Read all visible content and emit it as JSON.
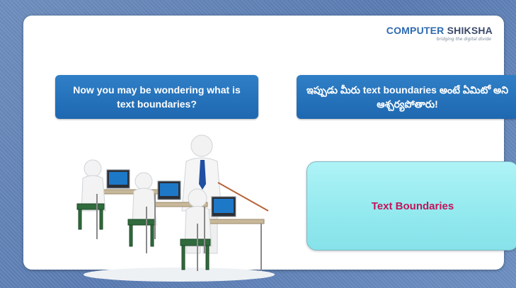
{
  "logo": {
    "brand_part1": "COMPUTER",
    "brand_part2": " SHIKSHA",
    "tagline": "bridging the digital divide"
  },
  "callouts": {
    "english": "Now you may be wondering what is text boundaries?",
    "telugu": "ఇప్పుడు మీరు text boundaries అంటే ఏమిటో అని ఆశ్చర్యపోతారు!"
  },
  "topic": {
    "label": "Text Boundaries"
  },
  "illustration": {
    "icon": "classroom-teacher-students-illustration"
  },
  "colors": {
    "background": "#5f82b7",
    "callout_blue": "#2574bd",
    "topic_fill": "#9ef0f3",
    "topic_text": "#c4135b"
  }
}
